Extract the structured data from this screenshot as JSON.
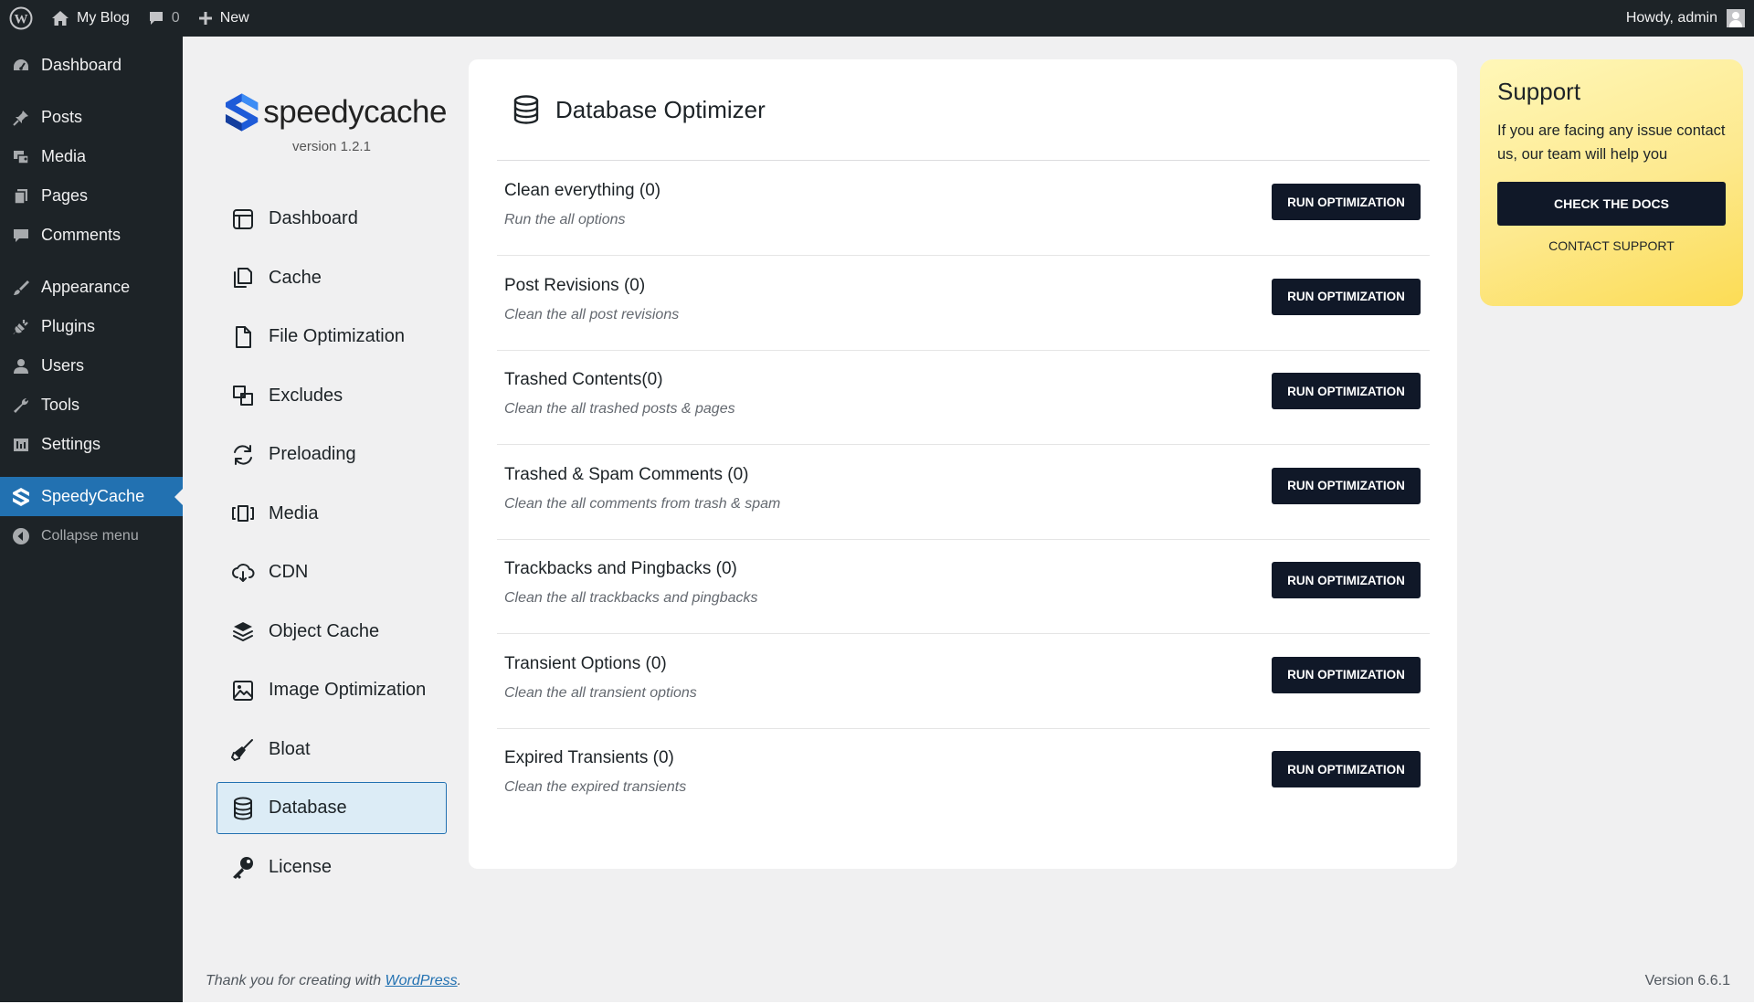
{
  "admin_bar": {
    "site_name": "My Blog",
    "comments_count": "0",
    "new_label": "New",
    "howdy": "Howdy, admin"
  },
  "wp_menu": {
    "items": [
      {
        "label": "Dashboard",
        "icon": "dashboard-icon"
      },
      {
        "label": "Posts",
        "icon": "pin-icon"
      },
      {
        "label": "Media",
        "icon": "media-icon"
      },
      {
        "label": "Pages",
        "icon": "pages-icon"
      },
      {
        "label": "Comments",
        "icon": "comment-icon"
      },
      {
        "label": "Appearance",
        "icon": "brush-icon"
      },
      {
        "label": "Plugins",
        "icon": "plugin-icon"
      },
      {
        "label": "Users",
        "icon": "user-icon"
      },
      {
        "label": "Tools",
        "icon": "wrench-icon"
      },
      {
        "label": "Settings",
        "icon": "settings-icon"
      },
      {
        "label": "SpeedyCache",
        "icon": "speedycache-icon",
        "current": true
      }
    ],
    "collapse_label": "Collapse menu"
  },
  "plugin": {
    "brand": "speedycache",
    "version": "version 1.2.1",
    "nav": [
      {
        "label": "Dashboard",
        "icon": "dashboard-icon"
      },
      {
        "label": "Cache",
        "icon": "cache-icon"
      },
      {
        "label": "File Optimization",
        "icon": "file-icon"
      },
      {
        "label": "Excludes",
        "icon": "excludes-icon"
      },
      {
        "label": "Preloading",
        "icon": "refresh-icon"
      },
      {
        "label": "Media",
        "icon": "media-icon"
      },
      {
        "label": "CDN",
        "icon": "cloud-icon"
      },
      {
        "label": "Object Cache",
        "icon": "layers-icon"
      },
      {
        "label": "Image Optimization",
        "icon": "image-icon"
      },
      {
        "label": "Bloat",
        "icon": "broom-icon"
      },
      {
        "label": "Database",
        "icon": "database-icon",
        "active": true
      },
      {
        "label": "License",
        "icon": "key-icon"
      }
    ]
  },
  "main": {
    "title": "Database Optimizer",
    "button_label": "RUN OPTIMIZATION",
    "rows": [
      {
        "title": "Clean everything (0)",
        "desc": "Run the all options"
      },
      {
        "title": "Post Revisions (0)",
        "desc": "Clean the all post revisions"
      },
      {
        "title": "Trashed Contents(0)",
        "desc": "Clean the all trashed posts & pages"
      },
      {
        "title": "Trashed & Spam Comments (0)",
        "desc": "Clean the all comments from trash & spam"
      },
      {
        "title": "Trackbacks and Pingbacks (0)",
        "desc": "Clean the all trackbacks and pingbacks"
      },
      {
        "title": "Transient Options (0)",
        "desc": "Clean the all transient options"
      },
      {
        "title": "Expired Transients (0)",
        "desc": "Clean the expired transients"
      }
    ]
  },
  "support": {
    "title": "Support",
    "text": "If you are facing any issue contact us, our team will help you",
    "docs_button": "CHECK THE DOCS",
    "contact_link": "CONTACT SUPPORT"
  },
  "footer": {
    "thanks_prefix": "Thank you for creating with ",
    "wordpress_link": "WordPress",
    "thanks_suffix": ".",
    "version": "Version 6.6.1"
  },
  "colors": {
    "admin_dark": "#1d2327",
    "wp_blue": "#2271b1",
    "button_dark": "#101828",
    "active_nav_bg": "#dcecf6",
    "support_yellow": "#fde98e"
  }
}
